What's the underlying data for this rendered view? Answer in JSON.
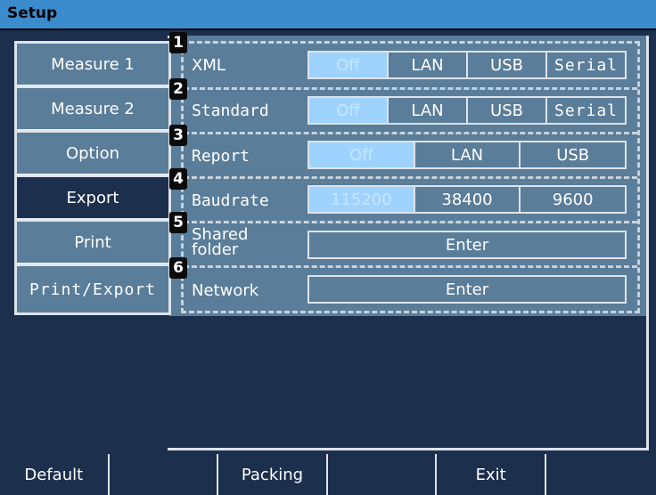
{
  "title": "Setup",
  "tabs": [
    {
      "label": "Measure 1"
    },
    {
      "label": "Measure 2"
    },
    {
      "label": "Option"
    },
    {
      "label": "Export"
    },
    {
      "label": "Print"
    },
    {
      "label": "Print/Export"
    }
  ],
  "active_tab": "Export",
  "rows": [
    {
      "badge": "1",
      "label": "XML",
      "options": [
        "Off",
        "LAN",
        "USB",
        "Serial"
      ],
      "selected": "Off"
    },
    {
      "badge": "2",
      "label": "Standard",
      "options": [
        "Off",
        "LAN",
        "USB",
        "Serial"
      ],
      "selected": "Off"
    },
    {
      "badge": "3",
      "label": "Report",
      "options": [
        "Off",
        "LAN",
        "USB"
      ],
      "selected": "Off"
    },
    {
      "badge": "4",
      "label": "Baudrate",
      "options": [
        "115200",
        "38400",
        "9600"
      ],
      "selected": "115200"
    },
    {
      "badge": "5",
      "label_line1": "Shared",
      "label_line2": "folder",
      "button": "Enter"
    },
    {
      "badge": "6",
      "label": "Network",
      "button": "Enter"
    }
  ],
  "footer": [
    "Default",
    "",
    "Packing",
    "",
    "Exit",
    ""
  ],
  "colors": {
    "background": "#1c2f4d",
    "panel": "#5a7d99",
    "selected": "#9fd3ff",
    "title_bar": "#3b8ccd"
  }
}
